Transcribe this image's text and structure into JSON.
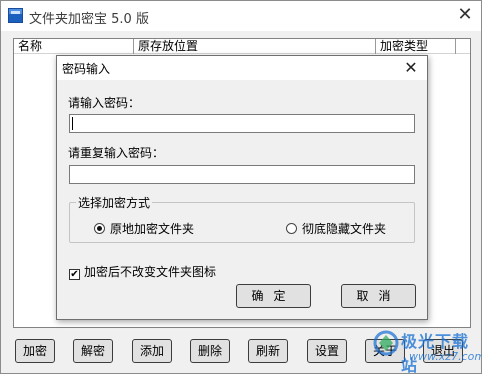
{
  "window": {
    "title": "文件夹加密宝 5.0 版",
    "close_label": "✕"
  },
  "list": {
    "columns": [
      "名称",
      "原存放位置",
      "加密类型"
    ]
  },
  "bottom_buttons": {
    "encrypt": "加密",
    "decrypt": "解密",
    "add": "添加",
    "delete": "删除",
    "refresh": "刷新",
    "settings": "设置",
    "about": "关于",
    "exit": "退出"
  },
  "dialog": {
    "title": "密码输入",
    "close_label": "✕",
    "password_label": "请输入密码：",
    "password_value": "",
    "confirm_label": "请重复输入密码：",
    "confirm_value": "",
    "mode_group_title": "选择加密方式",
    "mode_options": [
      {
        "label": "原地加密文件夹",
        "selected": true
      },
      {
        "label": "彻底隐藏文件夹",
        "selected": false
      }
    ],
    "keep_icon_label": "加密后不改变文件夹图标",
    "keep_icon_checked": true,
    "ok_label": "确定",
    "cancel_label": "取消"
  },
  "watermark": {
    "name": "极光下载站",
    "url": "www.xz7.com"
  },
  "colors": {
    "window_bg": "#f0f0f0",
    "titlebar_bg": "#ffffff",
    "button_bg": "#e1e1e1",
    "watermark": "#146ed2"
  }
}
